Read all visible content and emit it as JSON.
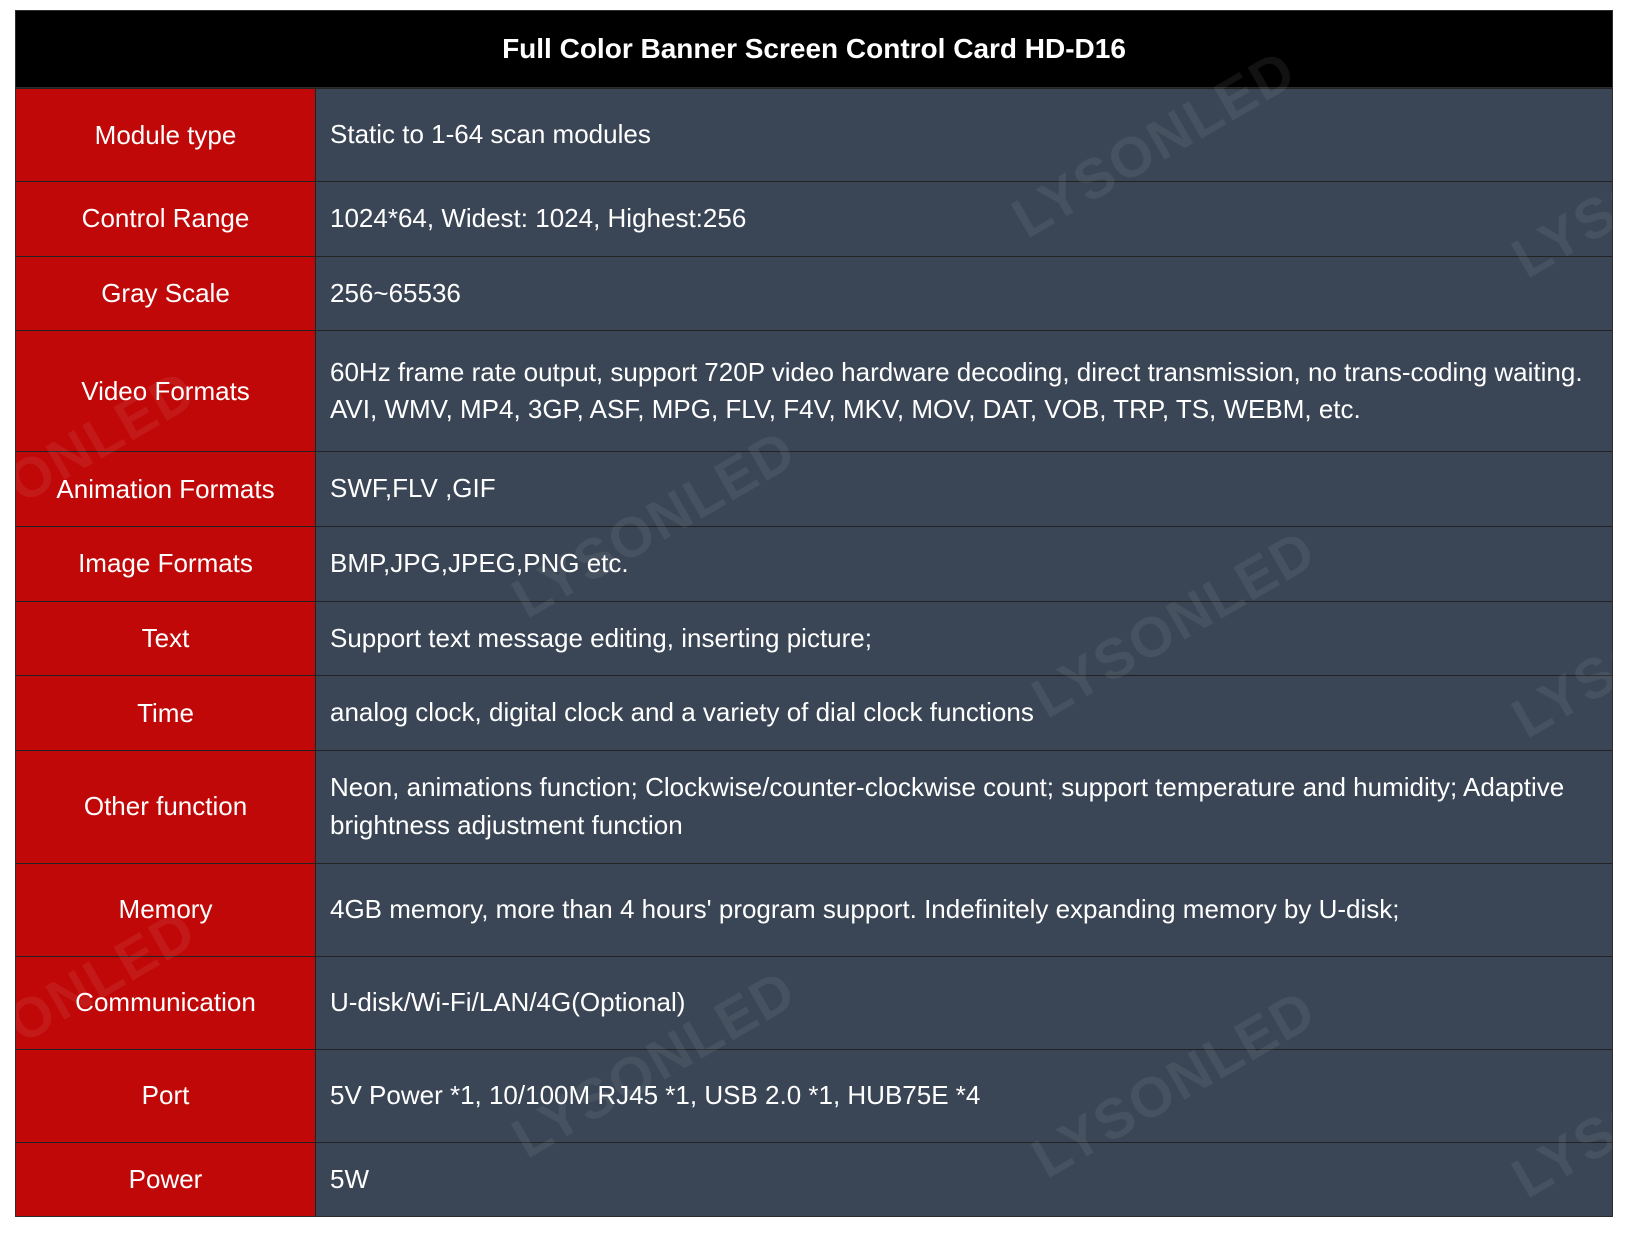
{
  "title": "Full Color Banner Screen Control Card HD-D16",
  "watermark": "LYSONLED",
  "rows": [
    {
      "label": "Module type",
      "value": "Static to 1-64 scan modules"
    },
    {
      "label": "Control Range",
      "value": "1024*64, Widest: 1024, Highest:256"
    },
    {
      "label": "Gray Scale",
      "value": "256~65536"
    },
    {
      "label": "Video Formats",
      "value": "60Hz frame rate output, support 720P video hardware decoding,   direct transmission, no trans-coding waiting. AVI, WMV, MP4, 3GP, ASF, MPG, FLV, F4V, MKV, MOV,   DAT, VOB, TRP, TS, WEBM, etc."
    },
    {
      "label": "Animation Formats",
      "value": "SWF,FLV ,GIF"
    },
    {
      "label": "Image Formats",
      "value": "BMP,JPG,JPEG,PNG etc."
    },
    {
      "label": "Text",
      "value": "Support text message editing, inserting picture;"
    },
    {
      "label": "Time",
      "value": "analog clock, digital clock and a variety of dial clock functions"
    },
    {
      "label": "Other function",
      "value": "Neon, animations function; Clockwise/counter-clockwise count; support   temperature and humidity; Adaptive brightness adjustment function"
    },
    {
      "label": "Memory",
      "value": "4GB memory, more than 4 hours' program support. Indefinitely   expanding memory by U-disk;"
    },
    {
      "label": "Communication",
      "value": "U-disk/Wi-Fi/LAN/4G(Optional)"
    },
    {
      "label": "Port",
      "value": "5V Power *1,   10/100M RJ45 *1, USB 2.0 *1, HUB75E *4"
    },
    {
      "label": "Power",
      "value": "5W"
    }
  ]
}
